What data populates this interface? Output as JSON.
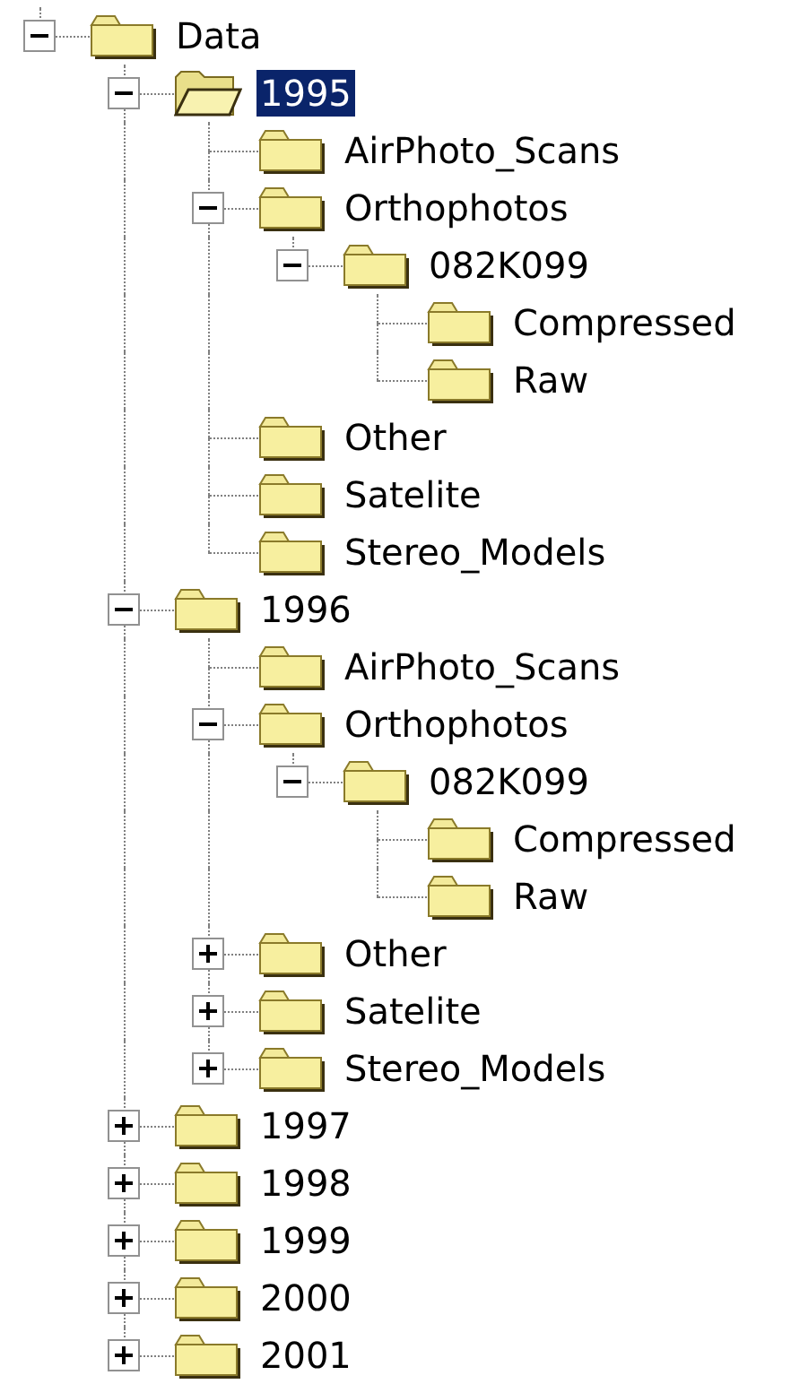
{
  "tree": {
    "label": "Data",
    "kind": "branch",
    "expanded": true,
    "selected": false,
    "children": [
      {
        "label": "1995",
        "kind": "branch",
        "expanded": true,
        "selected": true,
        "children": [
          {
            "label": "AirPhoto_Scans",
            "kind": "leaf",
            "selected": false
          },
          {
            "label": "Orthophotos",
            "kind": "branch",
            "expanded": true,
            "selected": false,
            "children": [
              {
                "label": "082K099",
                "kind": "branch",
                "expanded": true,
                "selected": false,
                "children": [
                  {
                    "label": "Compressed",
                    "kind": "leaf",
                    "selected": false
                  },
                  {
                    "label": "Raw",
                    "kind": "leaf",
                    "selected": false
                  }
                ]
              }
            ]
          },
          {
            "label": "Other",
            "kind": "leaf",
            "selected": false
          },
          {
            "label": "Satelite",
            "kind": "leaf",
            "selected": false
          },
          {
            "label": "Stereo_Models",
            "kind": "leaf",
            "selected": false
          }
        ]
      },
      {
        "label": "1996",
        "kind": "branch",
        "expanded": true,
        "selected": false,
        "children": [
          {
            "label": "AirPhoto_Scans",
            "kind": "leaf",
            "selected": false
          },
          {
            "label": "Orthophotos",
            "kind": "branch",
            "expanded": true,
            "selected": false,
            "children": [
              {
                "label": "082K099",
                "kind": "branch",
                "expanded": true,
                "selected": false,
                "children": [
                  {
                    "label": "Compressed",
                    "kind": "leaf",
                    "selected": false
                  },
                  {
                    "label": "Raw",
                    "kind": "leaf",
                    "selected": false
                  }
                ]
              }
            ]
          },
          {
            "label": "Other",
            "kind": "branch",
            "expanded": false,
            "selected": false
          },
          {
            "label": "Satelite",
            "kind": "branch",
            "expanded": false,
            "selected": false
          },
          {
            "label": "Stereo_Models",
            "kind": "branch",
            "expanded": false,
            "selected": false
          }
        ]
      },
      {
        "label": "1997",
        "kind": "branch",
        "expanded": false,
        "selected": false
      },
      {
        "label": "1998",
        "kind": "branch",
        "expanded": false,
        "selected": false
      },
      {
        "label": "1999",
        "kind": "branch",
        "expanded": false,
        "selected": false
      },
      {
        "label": "2000",
        "kind": "branch",
        "expanded": false,
        "selected": false
      },
      {
        "label": "2001",
        "kind": "branch",
        "expanded": false,
        "selected": false
      }
    ]
  }
}
